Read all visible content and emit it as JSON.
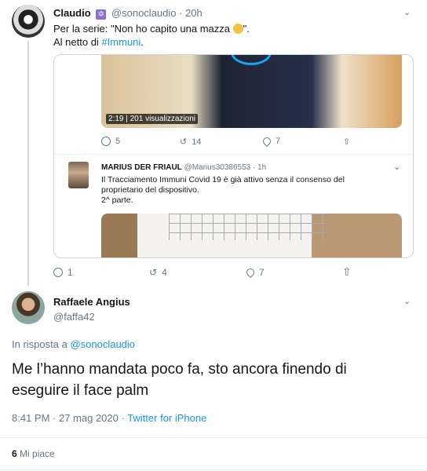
{
  "parent_tweet": {
    "name": "Claudio",
    "badge": "✡",
    "handle": "@sonoclaudio",
    "time": "· 20h",
    "text_line1_prefix": "Per la serie: \"Non ho capito una mazza ",
    "text_line1_suffix": "\".",
    "text_line2_prefix": "Al netto di ",
    "hashtag": "#Immuni",
    "text_line2_suffix": ".",
    "actions": {
      "replies": "1",
      "retweets": "4",
      "likes": "7"
    }
  },
  "quoted": {
    "video_badge": "2:19 | 201 visualizzazioni",
    "actions": {
      "replies": "5",
      "retweets": "14",
      "likes": "7"
    },
    "inner": {
      "name": "MARIUS DER FRIAUL",
      "handle": "@Marius30386553",
      "time": "· 1h",
      "text_line1": "Il Tracciamento Immuni Covid 19 è già attivo senza il consenso del",
      "text_line2": "proprietario del dispositivo.",
      "text_line3": "2^ parte."
    }
  },
  "reply_tweet": {
    "name": "Raffaele Angius",
    "handle": "@faffa42",
    "reply_prefix": "In risposta a ",
    "reply_to": "@sonoclaudio",
    "text_line1": "Me l’hanno mandata poco fa, sto ancora finendo di",
    "text_line2": "eseguire il face palm",
    "timestamp": "8:41 PM · 27 mag 2020 · ",
    "source": "Twitter for iPhone",
    "likes_count": "6",
    "likes_label": "Mi piace"
  },
  "colors": {
    "link": "#1b95e0",
    "muted": "#657786",
    "border": "#ccd6dd"
  }
}
